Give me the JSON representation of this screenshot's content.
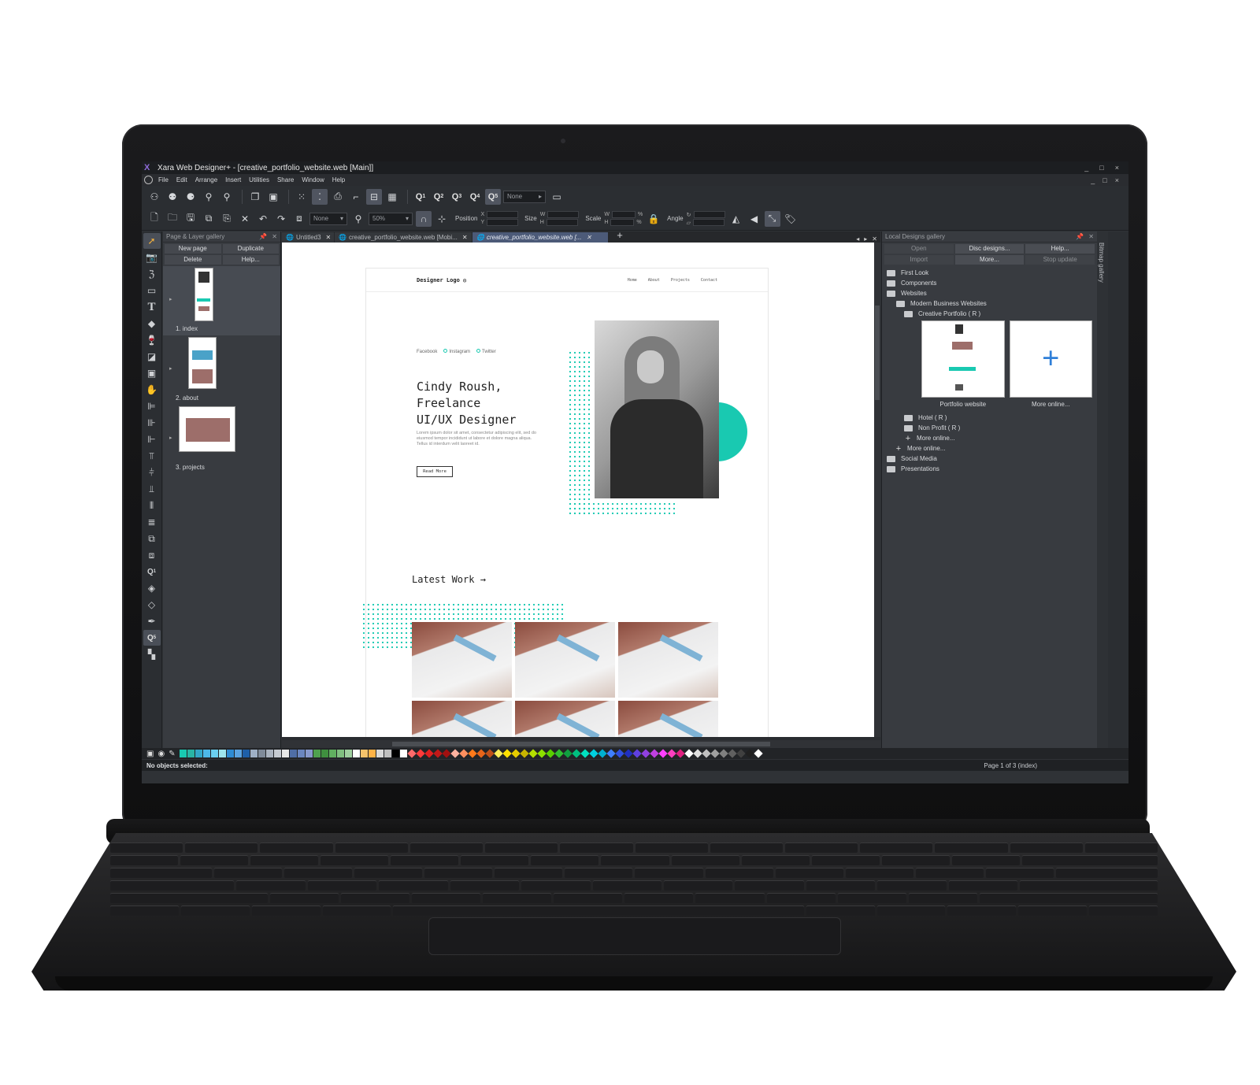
{
  "window": {
    "title": "Xara Web Designer+ - [creative_portfolio_website.web [Main]]",
    "controls": [
      "_",
      "□",
      "×"
    ]
  },
  "menu": [
    "File",
    "Edit",
    "Arrange",
    "Insert",
    "Utilities",
    "Share",
    "Window",
    "Help"
  ],
  "toolbar": {
    "quality_none": "None",
    "line_none": "None",
    "zoom": "50%",
    "position_label": "Position",
    "size_label": "Size",
    "scale_label": "Scale",
    "angle_label": "Angle",
    "x": "X",
    "y": "Y",
    "w": "W",
    "h": "H",
    "percent": "%"
  },
  "page_gallery": {
    "title": "Page & Layer gallery",
    "buttons": [
      "New page",
      "Duplicate",
      "Delete",
      "Help..."
    ],
    "pages": [
      "1. index",
      "2. about",
      "3. projects"
    ]
  },
  "tabs": [
    {
      "label": "Untitled3"
    },
    {
      "label": "creative_portfolio_website.web [Mobi..."
    },
    {
      "label": "creative_portfolio_website.web [..."
    }
  ],
  "site": {
    "logo": "Designer Logo ◎",
    "nav": [
      "Home",
      "About",
      "Projects",
      "Contact"
    ],
    "socials": [
      "Facebook",
      "Instagram",
      "Twitter"
    ],
    "headline": [
      "Cindy Roush,",
      "Freelance",
      "UI/UX Designer"
    ],
    "lorem": "Lorem ipsum dolor sit amet, consectetur adipiscing elit, sed do eiusmod tempor incididunt ut labore et dolore magna aliqua. Tellus id interdum velit laoreet id.",
    "read_more": "Read More",
    "latest_work": "Latest Work →"
  },
  "local_gallery": {
    "title": "Local Designs gallery",
    "buttons": [
      "Open",
      "Disc designs...",
      "Help...",
      "Import",
      "More...",
      "Stop update"
    ],
    "tree": {
      "first_look": "First Look",
      "components": "Components",
      "websites": "Websites",
      "modern_business": "Modern Business Websites",
      "creative_portfolio": "Creative Portfolio ( R )",
      "hotel": "Hotel ( R )",
      "non_profit": "Non Profit ( R )",
      "more_online_inner": "More online...",
      "more_online_outer": "More online...",
      "social_media": "Social Media",
      "presentations": "Presentations"
    },
    "cards": [
      "Portfolio website",
      "More online..."
    ],
    "bitmap_tab": "Bitmap gallery"
  },
  "palette_colors": [
    "#19c9b1",
    "#29b5a5",
    "#33a7c7",
    "#4db8e8",
    "#6ad0f0",
    "#9ee5ee",
    "#2e8bd3",
    "#5ba3e0",
    "#1e5fa8",
    "#9fb0c6",
    "#7f8a99",
    "#aab3bf",
    "#c6cbd2",
    "#e8e8e8",
    "#4f6ea6",
    "#6b86bf",
    "#8899cc",
    "#4fa14f",
    "#3f8f3f",
    "#60b060",
    "#80c080",
    "#a0d0a0",
    "#ffffff",
    "#f5c36b",
    "#ffb347",
    "#d9d9d9",
    "#bfbfbf",
    "#000000",
    "#ffffff"
  ],
  "palette_diamonds": [
    "#ff6b6b",
    "#ff3b3b",
    "#e02020",
    "#c01818",
    "#a01010",
    "#ffb3a0",
    "#ff9060",
    "#ff7a1a",
    "#e8651a",
    "#c0501a",
    "#ffee58",
    "#ffe000",
    "#e6cc00",
    "#c8b400",
    "#b4e000",
    "#8ee000",
    "#5ad000",
    "#30c030",
    "#10a040",
    "#00c080",
    "#00e0c0",
    "#00d0e0",
    "#00b0d0",
    "#4080ff",
    "#3050e0",
    "#2030c0",
    "#6040e0",
    "#9040e0",
    "#c040e0",
    "#ff40ff",
    "#ff40c0",
    "#e02080",
    "#ffffff",
    "#e0e0e0",
    "#c0c0c0",
    "#a0a0a0",
    "#808080",
    "#606060",
    "#404040",
    "#202020",
    "#ffffff"
  ],
  "status": {
    "left": "No objects selected:",
    "right": "Page 1 of 3 (index)"
  }
}
